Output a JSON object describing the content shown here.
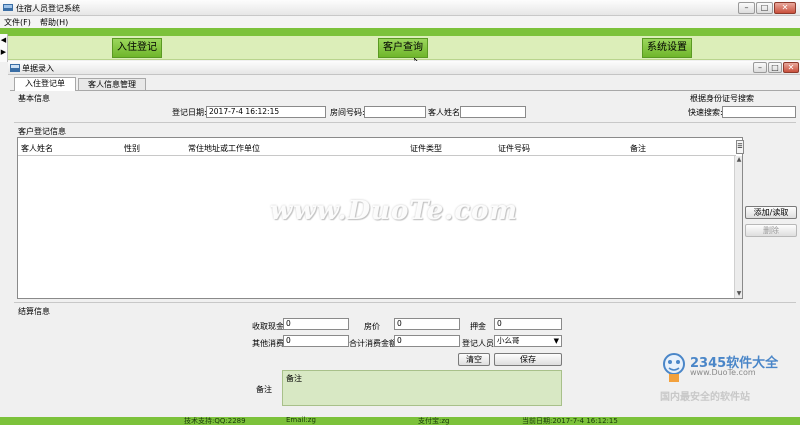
{
  "app": {
    "title": "住宿人员登记系统",
    "menu": [
      "文件(F)",
      "帮助(H)"
    ]
  },
  "nav": {
    "checkin": "入住登记",
    "query": "客户查询",
    "settings": "系统设置"
  },
  "window": {
    "title": "单据录入",
    "tabs": [
      "入住登记单",
      "客人信息管理"
    ]
  },
  "basic": {
    "section": "基本信息",
    "date_label": "登记日期:",
    "date_value": "2017-7-4 16:12:15",
    "room_label": "房间号码:",
    "room_value": "",
    "guest_label": "客人姓名:",
    "guest_value": ""
  },
  "id_search": {
    "section": "根据身份证号搜索",
    "label": "快速搜索:",
    "value": ""
  },
  "guests": {
    "section": "客户登记信息",
    "columns": [
      "客人姓名",
      "性别",
      "常住地址或工作单位",
      "证件类型",
      "证件号码",
      "备注"
    ],
    "add_button": "添加/读取",
    "delete_button": "删除"
  },
  "settlement": {
    "section": "结算信息",
    "cash_label": "收取现金",
    "cash_value": "0",
    "price_label": "房价",
    "price_value": "0",
    "deposit_label": "押金",
    "deposit_value": "0",
    "other_label": "其他消费",
    "other_value": "0",
    "total_label": "合计消费金额",
    "total_value": "0",
    "staff_label": "登记人员",
    "staff_value": "小么哥",
    "clear_button": "清空",
    "save_button": "保存",
    "notes_label": "备注",
    "notes_value": "备注"
  },
  "status": {
    "support": "技术支持:QQ:2289",
    "email": "Email:zg",
    "pay": "支付宝:zg",
    "date": "当前日期:2017-7-4 16:12:15"
  },
  "watermark": {
    "duote": "www.DuoTe.com",
    "brand": "2345软件大全",
    "site": "www.DuoTe.com",
    "slogan": "国内最安全的软件站"
  },
  "colors": {
    "accent_green": "#7cc23b",
    "nav_bg": "#dceeb9",
    "notes_bg": "#d8e8c4"
  }
}
